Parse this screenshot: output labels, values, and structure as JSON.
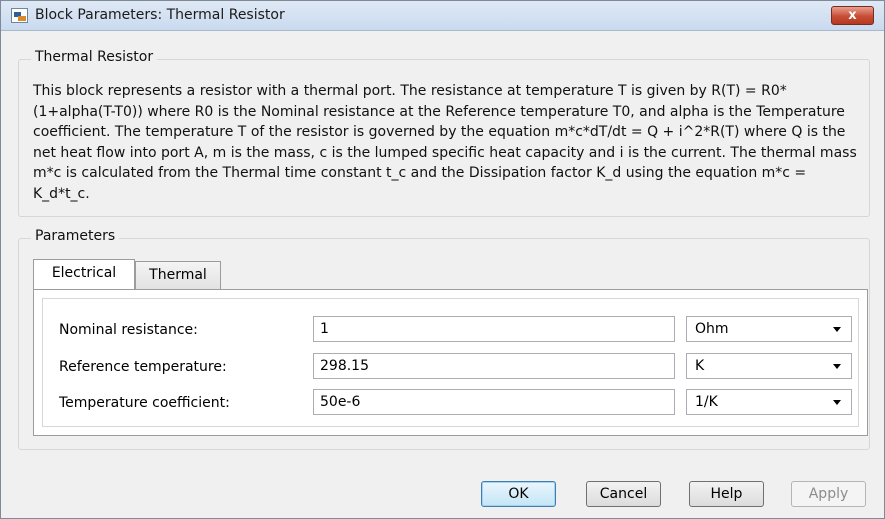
{
  "window": {
    "title": "Block Parameters: Thermal Resistor",
    "close_glyph": "x"
  },
  "block": {
    "group_title": "Thermal Resistor",
    "description": "This block represents a resistor with a thermal port. The resistance at temperature T is given by R(T) = R0*(1+alpha(T-T0)) where R0 is the Nominal resistance at the Reference temperature T0, and alpha is the Temperature coefficient. The temperature T of the resistor is governed by the equation m*c*dT/dt = Q + i^2*R(T) where Q is the net heat flow into port A, m is the mass, c is the lumped specific heat capacity and i is the current. The thermal mass m*c is calculated from the Thermal time constant t_c and the Dissipation factor K_d using the equation m*c = K_d*t_c."
  },
  "parameters": {
    "group_title": "Parameters",
    "tabs": [
      {
        "label": "Electrical",
        "active": true
      },
      {
        "label": "Thermal",
        "active": false
      }
    ],
    "rows": [
      {
        "label": "Nominal resistance:",
        "value": "1",
        "unit": "Ohm"
      },
      {
        "label": "Reference temperature:",
        "value": "298.15",
        "unit": "K"
      },
      {
        "label": "Temperature coefficient:",
        "value": "50e-6",
        "unit": "1/K"
      }
    ]
  },
  "buttons": {
    "ok": "OK",
    "cancel": "Cancel",
    "help": "Help",
    "apply": "Apply"
  },
  "colors": {
    "close_button": "#c74e36",
    "default_button_border": "#3c7fb1",
    "dialog_background": "#f0f0f0"
  }
}
